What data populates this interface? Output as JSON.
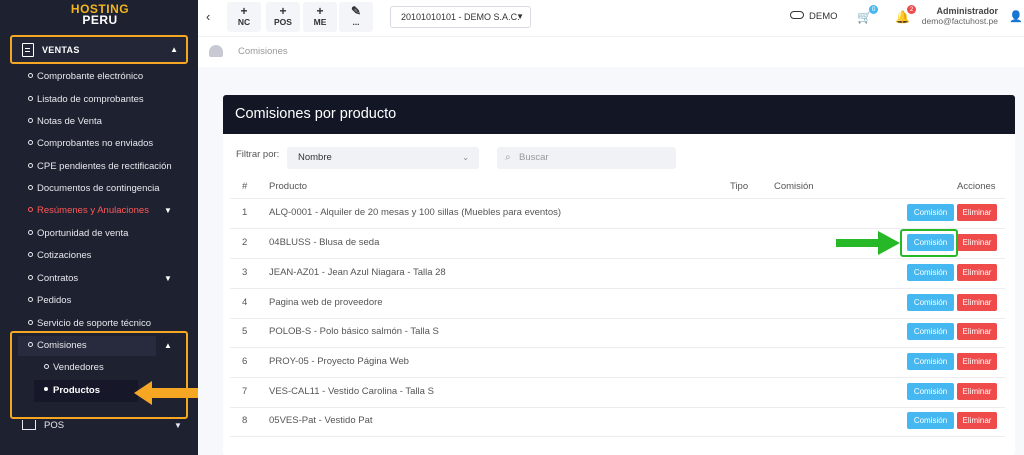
{
  "logo": {
    "line1": "HOSTING",
    "line2": "PERU"
  },
  "sidebar": {
    "section": "VENTAS",
    "items": [
      {
        "label": "Comprobante electrónico"
      },
      {
        "label": "Listado de comprobantes"
      },
      {
        "label": "Notas de Venta"
      },
      {
        "label": "Comprobantes no enviados"
      },
      {
        "label": "CPE pendientes de rectificación"
      },
      {
        "label": "Documentos de contingencia"
      },
      {
        "label": "Resúmenes y Anulaciones"
      },
      {
        "label": "Oportunidad de venta"
      },
      {
        "label": "Cotizaciones"
      },
      {
        "label": "Contratos"
      },
      {
        "label": "Pedidos"
      },
      {
        "label": "Servicio de soporte técnico"
      }
    ],
    "comisiones": {
      "label": "Comisiones",
      "sub": [
        {
          "label": "Vendedores"
        },
        {
          "label": "Productos"
        }
      ]
    },
    "pos": "POS",
    "highlight_color": "#f5a623"
  },
  "header": {
    "buttons": [
      {
        "icon": "plus-icon",
        "label": "NC"
      },
      {
        "icon": "plus-icon",
        "label": "POS"
      },
      {
        "icon": "plus-icon",
        "label": "ME"
      },
      {
        "icon": "pencil-icon",
        "label": "..."
      }
    ],
    "company": "20101010101 - DEMO S.A.C.",
    "mode": "DEMO",
    "cart_badge": "0",
    "bell_badge": "2",
    "user_name": "Administrador",
    "user_email": "demo@factuhost.pe"
  },
  "breadcrumb": "Comisiones",
  "page": {
    "title": "Comisiones por producto",
    "filter_label": "Filtrar por:",
    "filter_value": "Nombre",
    "search_placeholder": "Buscar",
    "columns": {
      "num": "#",
      "product": "Producto",
      "tipo": "Tipo",
      "comision": "Comisión",
      "acciones": "Acciones"
    },
    "rows": [
      {
        "num": "1",
        "product": "ALQ-0001 - Alquiler de 20 mesas y 100 sillas (Muebles para eventos)"
      },
      {
        "num": "2",
        "product": "04BLUSS - Blusa de seda"
      },
      {
        "num": "3",
        "product": "JEAN-AZ01 - Jean Azul Niagara - Talla 28"
      },
      {
        "num": "4",
        "product": "Pagina web de proveedore"
      },
      {
        "num": "5",
        "product": "POLOB-S - Polo básico salmón - Talla S"
      },
      {
        "num": "6",
        "product": "PROY-05 - Proyecto Página Web"
      },
      {
        "num": "7",
        "product": "VES-CAL11 - Vestido Carolina - Talla S"
      },
      {
        "num": "8",
        "product": "05VES-Pat - Vestido Pat"
      }
    ],
    "btn_comision": "Comisión",
    "btn_eliminar": "Eliminar",
    "colors": {
      "comision": "#45b8f2",
      "eliminar": "#ef4b4b",
      "highlight": "#27b827"
    }
  }
}
